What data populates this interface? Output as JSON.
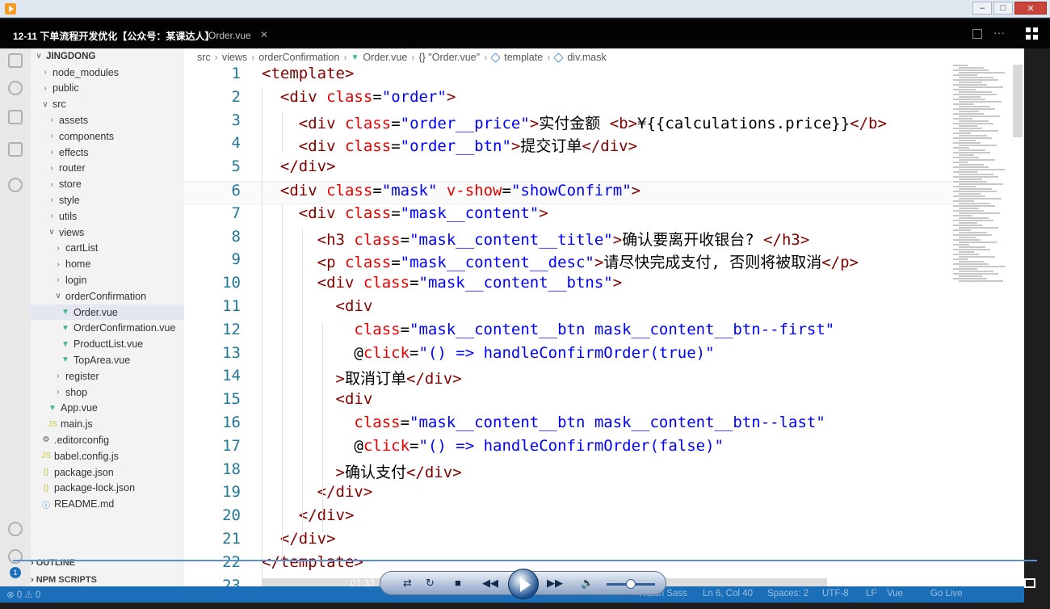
{
  "window": {
    "title": "12-11 下单流程开发优化【公众号：某课达人】",
    "tab": "Order.vue",
    "time": "01:33"
  },
  "explorer": {
    "root": "JINGDONG",
    "items": [
      {
        "label": "node_modules",
        "kind": "folder",
        "open": false
      },
      {
        "label": "public",
        "kind": "folder",
        "open": false
      },
      {
        "label": "src",
        "kind": "folder",
        "open": true
      },
      {
        "label": "assets",
        "kind": "folder",
        "open": false
      },
      {
        "label": "components",
        "kind": "folder",
        "open": false
      },
      {
        "label": "effects",
        "kind": "folder",
        "open": false
      },
      {
        "label": "router",
        "kind": "folder",
        "open": false
      },
      {
        "label": "store",
        "kind": "folder",
        "open": false
      },
      {
        "label": "style",
        "kind": "folder",
        "open": false
      },
      {
        "label": "utils",
        "kind": "folder",
        "open": false
      },
      {
        "label": "views",
        "kind": "folder",
        "open": true
      },
      {
        "label": "cartList",
        "kind": "folder",
        "open": false
      },
      {
        "label": "home",
        "kind": "folder",
        "open": false
      },
      {
        "label": "login",
        "kind": "folder",
        "open": false
      },
      {
        "label": "orderConfirmation",
        "kind": "folder",
        "open": true
      },
      {
        "label": "Order.vue",
        "kind": "vue",
        "selected": true
      },
      {
        "label": "OrderConfirmation.vue",
        "kind": "vue"
      },
      {
        "label": "ProductList.vue",
        "kind": "vue"
      },
      {
        "label": "TopArea.vue",
        "kind": "vue"
      },
      {
        "label": "register",
        "kind": "folder",
        "open": false
      },
      {
        "label": "shop",
        "kind": "folder",
        "open": false
      },
      {
        "label": "App.vue",
        "kind": "vue"
      },
      {
        "label": "main.js",
        "kind": "js"
      },
      {
        "label": ".editorconfig",
        "kind": "gear"
      },
      {
        "label": "babel.config.js",
        "kind": "js"
      },
      {
        "label": "package.json",
        "kind": "json"
      },
      {
        "label": "package-lock.json",
        "kind": "json"
      },
      {
        "label": "README.md",
        "kind": "md"
      }
    ],
    "outline_label": "OUTLINE",
    "npm_label": "NPM SCRIPTS"
  },
  "breadcrumb": [
    "src",
    "views",
    "orderConfirmation",
    "Order.vue",
    "{} \"Order.vue\"",
    "template",
    "div.mask"
  ],
  "code": [
    {
      "n": "1",
      "t": "<template>"
    },
    {
      "n": "2",
      "t": "  <div class=\"order\">"
    },
    {
      "n": "3",
      "t": "    <div class=\"order__price\">实付金额 <b>¥{{calculations.price}}</b>"
    },
    {
      "n": "4",
      "t": "    <div class=\"order__btn\">提交订单</div>"
    },
    {
      "n": "5",
      "t": "  </div>"
    },
    {
      "n": "6",
      "t": "  <div class=\"mask\" v-show=\"showConfirm\">"
    },
    {
      "n": "7",
      "t": "    <div class=\"mask__content\">"
    },
    {
      "n": "8",
      "t": "      <h3 class=\"mask__content__title\">确认要离开收银台? </h3>"
    },
    {
      "n": "9",
      "t": "      <p class=\"mask__content__desc\">请尽快完成支付, 否则将被取消</p>"
    },
    {
      "n": "10",
      "t": "      <div class=\"mask__content__btns\">"
    },
    {
      "n": "11",
      "t": "        <div"
    },
    {
      "n": "12",
      "t": "          class=\"mask__content__btn mask__content__btn--first\""
    },
    {
      "n": "13",
      "t": "          @click=\"() => handleConfirmOrder(true)\""
    },
    {
      "n": "14",
      "t": "        >取消订单</div>"
    },
    {
      "n": "15",
      "t": "        <div"
    },
    {
      "n": "16",
      "t": "          class=\"mask__content__btn mask__content__btn--last\""
    },
    {
      "n": "17",
      "t": "          @click=\"() => handleConfirmOrder(false)\""
    },
    {
      "n": "18",
      "t": "        >确认支付</div>"
    },
    {
      "n": "19",
      "t": "      </div>"
    },
    {
      "n": "20",
      "t": "    </div>"
    },
    {
      "n": "21",
      "t": "  </div>"
    },
    {
      "n": "22",
      "t": "</template>"
    },
    {
      "n": "23",
      "t": ""
    }
  ],
  "status": {
    "left": "⊗ 0 ⚠ 0",
    "watch": "Watch Sass",
    "position": "Ln 6, Col 40",
    "spaces": "Spaces: 2",
    "encoding": "UTF-8",
    "eol": "LF",
    "lang": "Vue",
    "live": "Go Live"
  },
  "colors": {
    "tag": "#800000",
    "attr": "#e50000",
    "string": "#0000ff",
    "fn": "#795e26",
    "status": "#1b6fb8"
  }
}
